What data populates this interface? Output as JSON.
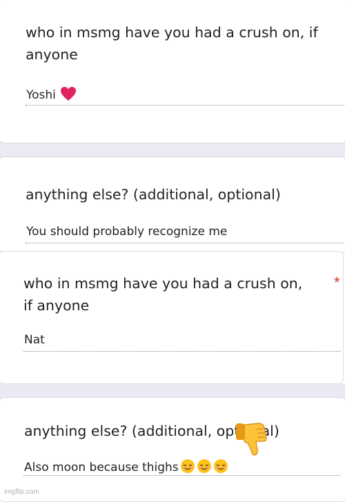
{
  "screenshot_1": {
    "question": "who in msmg have you had a crush on, if anyone",
    "answer": "Yoshi",
    "answer_emoji": "red-heart"
  },
  "screenshot_2": {
    "question": "anything else? (additional, optional)",
    "answer": "You should probably recognize me"
  },
  "screenshot_3": {
    "question": "who in msmg have you had a crush on, if anyone",
    "required_marker": "*",
    "answer": "Nat"
  },
  "screenshot_4": {
    "question": "anything else? (additional, optional)",
    "answer": "Also moon because thighs",
    "answer_emojis": [
      "smiling-relieved",
      "smiling-relieved",
      "smiling-relieved"
    ]
  },
  "overlay_emoji": "thumbs-down",
  "watermark": "imgflip.com",
  "colors": {
    "background_band": "#ece8f4",
    "required": "#d93025",
    "text": "#202124"
  }
}
